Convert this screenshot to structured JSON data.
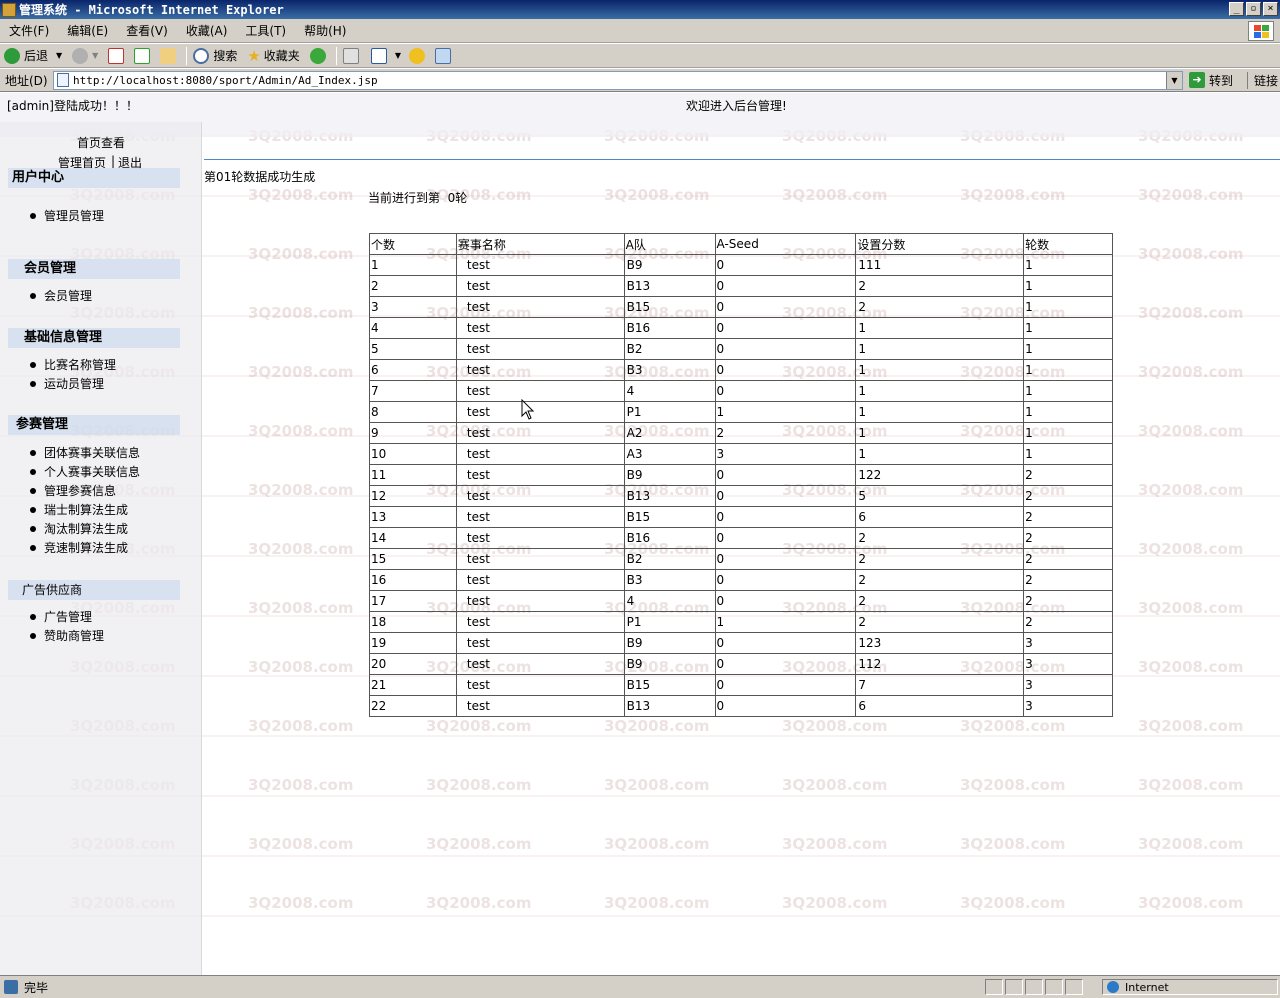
{
  "window": {
    "title": "管理系统 - Microsoft Internet Explorer",
    "buttons": [
      "_",
      "▫",
      "×"
    ]
  },
  "menu": [
    "文件(F)",
    "编辑(E)",
    "查看(V)",
    "收藏(A)",
    "工具(T)",
    "帮助(H)"
  ],
  "toolbar": {
    "back_label": "后退",
    "search_label": "搜索",
    "favorites_label": "收藏夹"
  },
  "address": {
    "label": "地址(D)",
    "url": "http://localhost:8080/sport/Admin/Ad_Index.jsp",
    "go_label": "转到",
    "links_label": "链接"
  },
  "header": {
    "login_msg": "[admin]登陆成功！！！",
    "welcome": "欢迎进入后台管理!"
  },
  "sidebar": {
    "home_view": "首页查看",
    "admin_home": "管理首页",
    "separator": "|",
    "logout": "退出",
    "sections": [
      {
        "title": "用户中心",
        "items": [
          "管理员管理"
        ]
      },
      {
        "title": "会员管理",
        "items": [
          "会员管理"
        ]
      },
      {
        "title": "基础信息管理",
        "items": [
          "比赛名称管理",
          "运动员管理"
        ]
      },
      {
        "title": "参赛管理",
        "items": [
          "团体赛事关联信息",
          "个人赛事关联信息",
          "管理参赛信息",
          "瑞士制算法生成",
          "淘汰制算法生成",
          "竞速制算法生成"
        ]
      },
      {
        "title": "广告供应商",
        "items": [
          "广告管理",
          "赞助商管理"
        ]
      }
    ]
  },
  "main": {
    "gen_msg": "第01轮数据成功生成",
    "round_msg": "当前进行到第  0轮",
    "columns": [
      "个数",
      "赛事名称",
      "A队",
      "A-Seed",
      "设置分数",
      "轮数"
    ],
    "rows": [
      [
        "1",
        "test",
        "B9",
        "0",
        "111",
        "1"
      ],
      [
        "2",
        "test",
        "B13",
        "0",
        "2",
        "1"
      ],
      [
        "3",
        "test",
        "B15",
        "0",
        "2",
        "1"
      ],
      [
        "4",
        "test",
        "B16",
        "0",
        "1",
        "1"
      ],
      [
        "5",
        "test",
        "B2",
        "0",
        "1",
        "1"
      ],
      [
        "6",
        "test",
        "B3",
        "0",
        "1",
        "1"
      ],
      [
        "7",
        "test",
        "4",
        "0",
        "1",
        "1"
      ],
      [
        "8",
        "test",
        "P1",
        "1",
        "1",
        "1"
      ],
      [
        "9",
        "test",
        "A2",
        "2",
        "1",
        "1"
      ],
      [
        "10",
        "test",
        "A3",
        "3",
        "1",
        "1"
      ],
      [
        "11",
        "test",
        "B9",
        "0",
        "122",
        "2"
      ],
      [
        "12",
        "test",
        "B13",
        "0",
        "5",
        "2"
      ],
      [
        "13",
        "test",
        "B15",
        "0",
        "6",
        "2"
      ],
      [
        "14",
        "test",
        "B16",
        "0",
        "2",
        "2"
      ],
      [
        "15",
        "test",
        "B2",
        "0",
        "2",
        "2"
      ],
      [
        "16",
        "test",
        "B3",
        "0",
        "2",
        "2"
      ],
      [
        "17",
        "test",
        "4",
        "0",
        "2",
        "2"
      ],
      [
        "18",
        "test",
        "P1",
        "1",
        "2",
        "2"
      ],
      [
        "19",
        "test",
        "B9",
        "0",
        "123",
        "3"
      ],
      [
        "20",
        "test",
        "B9",
        "0",
        "112",
        "3"
      ],
      [
        "21",
        "test",
        "B15",
        "0",
        "7",
        "3"
      ],
      [
        "22",
        "test",
        "B13",
        "0",
        "6",
        "3"
      ]
    ]
  },
  "watermark": "3Q2008.com",
  "status": {
    "text": "完毕",
    "zone": "Internet"
  }
}
